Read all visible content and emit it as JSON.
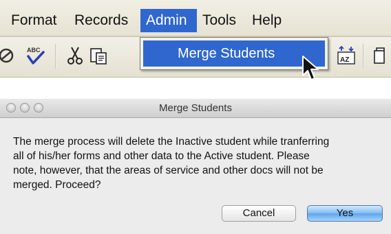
{
  "app": {
    "menubar": {
      "items": [
        {
          "label": "Format"
        },
        {
          "label": "Records"
        },
        {
          "label": "Admin"
        },
        {
          "label": "Tools"
        },
        {
          "label": "Help"
        }
      ],
      "active_item": "Admin"
    },
    "admin_menu": {
      "items": [
        {
          "label": "Merge Students",
          "highlighted": true
        }
      ]
    },
    "toolbar": {
      "icons": [
        "spell-check-icon",
        "cut-icon",
        "paste-icon",
        "sort-az-icon"
      ]
    },
    "colors": {
      "menu_highlight": "#2f67cf"
    }
  },
  "dialog": {
    "title": "Merge Students",
    "message": "The merge process will delete the Inactive student while tranferring\nall of his/her forms and other data to the Active student.  Please\nnote, however, that the areas of service and other docs will not be\nmerged. Proceed?",
    "buttons": {
      "cancel": "Cancel",
      "yes": "Yes"
    },
    "default_button": "Yes"
  }
}
